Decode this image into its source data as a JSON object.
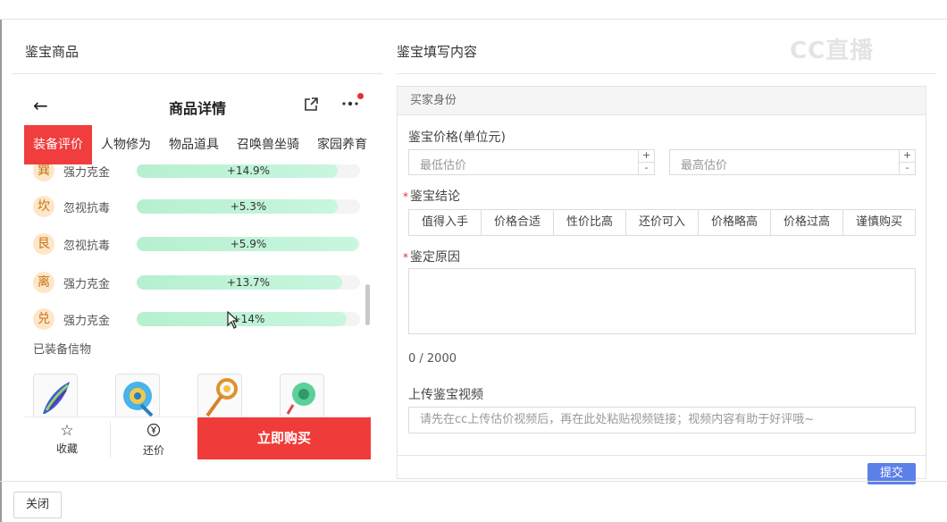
{
  "left_panel": {
    "title": "鉴宝商品",
    "phone": {
      "header_title": "商品详情",
      "back_icon": "arrow-left-icon",
      "share_icon": "share-icon",
      "more_icon": "more-icon",
      "tabs": [
        {
          "label": "装备评价",
          "active": true
        },
        {
          "label": "人物修为",
          "active": false
        },
        {
          "label": "物品道具",
          "active": false
        },
        {
          "label": "召唤兽坐骑",
          "active": false
        },
        {
          "label": "家园养育",
          "active": false
        }
      ],
      "stats": [
        {
          "badge": "巽",
          "name": "强力克金",
          "value": "+14.9%",
          "fill": 0.9
        },
        {
          "badge": "坎",
          "name": "忽视抗毒",
          "value": "+5.3%",
          "fill": 0.9
        },
        {
          "badge": "艮",
          "name": "忽视抗毒",
          "value": "+5.9%",
          "fill": 0.99
        },
        {
          "badge": "离",
          "name": "强力克金",
          "value": "+13.7%",
          "fill": 0.92
        },
        {
          "badge": "兑",
          "name": "强力克金",
          "value": "+14%",
          "fill": 0.94
        }
      ],
      "equip_title": "已装备信物",
      "equip_icons": [
        "feather-icon",
        "fan-icon",
        "staff-icon",
        "jade-icon"
      ],
      "bottom": {
        "favorite_label": "收藏",
        "favorite_icon": "star-icon",
        "bargain_label": "还价",
        "bargain_icon": "yen-icon",
        "buy_label": "立即购买"
      }
    }
  },
  "right_panel": {
    "title": "鉴宝填写内容",
    "watermark": "CC直播",
    "section_header": "买家身份",
    "price_label": "鉴宝价格(单位元)",
    "min_placeholder": "最低估价",
    "max_placeholder": "最高估价",
    "step_plus": "+",
    "step_minus": "-",
    "conclusion_label": "鉴宝结论",
    "conclusions": [
      "值得入手",
      "价格合适",
      "性价比高",
      "还价可入",
      "价格略高",
      "价格过高",
      "谨慎购买"
    ],
    "reason_label": "鉴定原因",
    "counter": "0 / 2000",
    "video_label": "上传鉴宝视频",
    "video_placeholder": "请先在cc上传估价视频后，再在此处粘贴视频链接；视频内容有助于好评哦~",
    "submit_label": "提交",
    "required_mark": "*"
  },
  "footer": {
    "close_label": "关闭"
  },
  "colors": {
    "accent_red": "#ef3c3a",
    "submit_blue": "#5d7fe8",
    "stat_fill": "#b6f0d0"
  }
}
